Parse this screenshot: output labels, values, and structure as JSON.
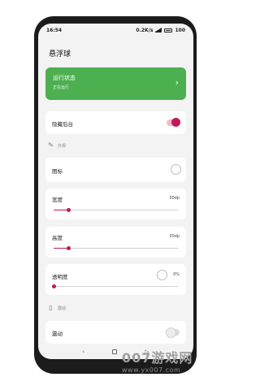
{
  "status_bar": {
    "time": "16:54",
    "speed": "0.2K/s",
    "battery": "100"
  },
  "page": {
    "title": "悬浮球"
  },
  "run_status": {
    "title": "运行状态",
    "subtitle": "正在运行"
  },
  "hide_background": {
    "label": "隐藏后台",
    "enabled": true
  },
  "appearance_section": {
    "label": "外观",
    "icon": "palette-icon"
  },
  "icon_setting": {
    "label": "图标"
  },
  "width_setting": {
    "label": "宽度",
    "value": "30dp",
    "fraction": 0.12
  },
  "height_setting": {
    "label": "高度",
    "value": "30dp",
    "fraction": 0.12
  },
  "opacity_setting": {
    "label": "透明度",
    "value": "0%",
    "fraction": 0.0
  },
  "vibration_section": {
    "label": "震动",
    "icon": "vibration-icon"
  },
  "vibration_setting": {
    "label": "震动",
    "enabled": false
  },
  "navigation": {
    "back": "‹",
    "recents": "▷"
  },
  "watermark": {
    "line1": "007游戏网",
    "line2": "www.yx007.com"
  },
  "colors": {
    "accent": "#c2185b",
    "primary_card": "#4caf50"
  }
}
